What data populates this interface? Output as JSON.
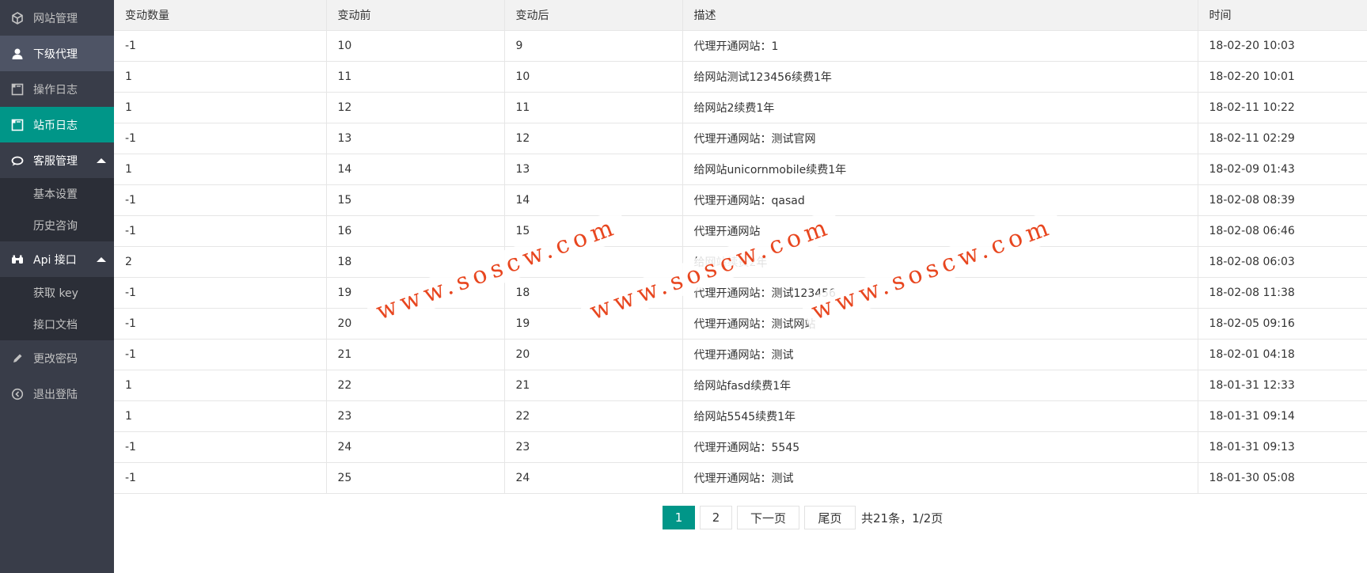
{
  "colors": {
    "sidebar_bg": "#393d49",
    "sidebar_sub_bg": "#2b2e37",
    "accent": "#009688",
    "watermark": "#e8461f"
  },
  "sidebar": {
    "items": [
      {
        "label": "网站管理",
        "icon": "cube-icon"
      },
      {
        "label": "下级代理",
        "icon": "user-icon"
      },
      {
        "label": "操作日志",
        "icon": "frame-icon"
      },
      {
        "label": "站币日志",
        "icon": "frame-icon"
      },
      {
        "label": "客服管理",
        "icon": "chat-icon"
      },
      {
        "label": "Api 接口",
        "icon": "binoculars-icon"
      },
      {
        "label": "更改密码",
        "icon": "pencil-icon"
      },
      {
        "label": "退出登陆",
        "icon": "logout-icon"
      }
    ],
    "kefu_sub": [
      {
        "label": "基本设置"
      },
      {
        "label": "历史咨询"
      }
    ],
    "api_sub": [
      {
        "label": "获取 key"
      },
      {
        "label": "接口文档"
      }
    ]
  },
  "table": {
    "headers": [
      "变动数量",
      "变动前",
      "变动后",
      "描述",
      "时间"
    ],
    "rows": [
      [
        "-1",
        "10",
        "9",
        "代理开通网站：1",
        "18-02-20 10:03"
      ],
      [
        "1",
        "11",
        "10",
        "给网站测试123456续费1年",
        "18-02-20 10:01"
      ],
      [
        "1",
        "12",
        "11",
        "给网站2续费1年",
        "18-02-11 10:22"
      ],
      [
        "-1",
        "13",
        "12",
        "代理开通网站：测试官网",
        "18-02-11 02:29"
      ],
      [
        "1",
        "14",
        "13",
        "给网站unicornmobile续费1年",
        "18-02-09 01:43"
      ],
      [
        "-1",
        "15",
        "14",
        "代理开通网站：qasad",
        "18-02-08 08:39"
      ],
      [
        "-1",
        "16",
        "15",
        "代理开通网站",
        "18-02-08 06:46"
      ],
      [
        "2",
        "18",
        "",
        "给网站续费2年",
        "18-02-08 06:03"
      ],
      [
        "-1",
        "19",
        "18",
        "代理开通网站：测试123456",
        "18-02-08 11:38"
      ],
      [
        "-1",
        "20",
        "19",
        "代理开通网站：测试网站",
        "18-02-05 09:16"
      ],
      [
        "-1",
        "21",
        "20",
        "代理开通网站：测试",
        "18-02-01 04:18"
      ],
      [
        "1",
        "22",
        "21",
        "给网站fasd续费1年",
        "18-01-31 12:33"
      ],
      [
        "1",
        "23",
        "22",
        "给网站5545续费1年",
        "18-01-31 09:14"
      ],
      [
        "-1",
        "24",
        "23",
        "代理开通网站：5545",
        "18-01-31 09:13"
      ],
      [
        "-1",
        "25",
        "24",
        "代理开通网站：测试",
        "18-01-30 05:08"
      ]
    ]
  },
  "pagination": {
    "pages": [
      "1",
      "2"
    ],
    "current": "1",
    "next_label": "下一页",
    "last_label": "尾页",
    "info": "共21条，1/2页"
  },
  "watermark": {
    "text": "www.soscw.com"
  }
}
